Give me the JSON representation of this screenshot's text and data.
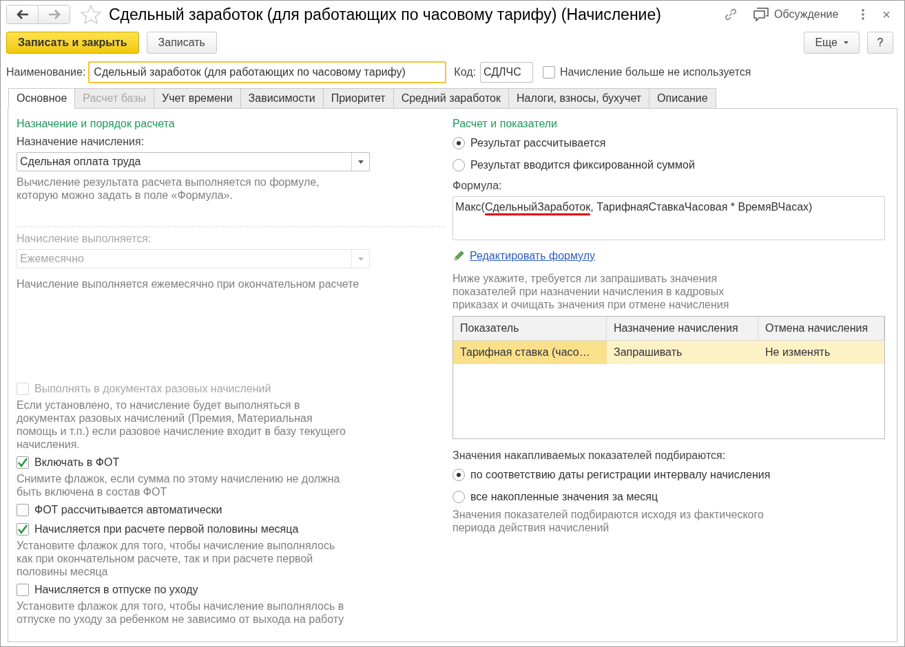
{
  "window": {
    "title": "Сдельный заработок (для работающих по часовому тарифу) (Начисление)",
    "favorite": false,
    "discussion": "Обсуждение",
    "close": "×"
  },
  "toolbar": {
    "primary": "Записать и закрыть",
    "secondary": "Записать",
    "more": "Еще",
    "help": "?"
  },
  "name_field": {
    "label": "Наименование:",
    "value": "Сдельный заработок (для работающих по часовому тарифу)"
  },
  "code_field": {
    "label": "Код:",
    "value": "СДЛЧС"
  },
  "not_used": {
    "label": "Начисление больше не используется",
    "checked": false
  },
  "tabs": [
    {
      "label": "Основное",
      "selected": true,
      "disabled": false
    },
    {
      "label": "Расчет базы",
      "selected": false,
      "disabled": true
    },
    {
      "label": "Учет времени",
      "selected": false,
      "disabled": false
    },
    {
      "label": "Зависимости",
      "selected": false,
      "disabled": false
    },
    {
      "label": "Приоритет",
      "selected": false,
      "disabled": false
    },
    {
      "label": "Средний заработок",
      "selected": false,
      "disabled": false
    },
    {
      "label": "Налоги, взносы, бухучет",
      "selected": false,
      "disabled": false
    },
    {
      "label": "Описание",
      "selected": false,
      "disabled": false
    }
  ],
  "left": {
    "section_title": "Назначение и порядок расчета",
    "purpose": {
      "label": "Назначение начисления:",
      "value": "Сдельная оплата труда",
      "disabled": false
    },
    "purpose_hint": "Вычисление результата расчета выполняется по формуле, которую можно задать в поле «Формула».",
    "frequency": {
      "label": "Начисление выполняется:",
      "value": "Ежемесячно",
      "disabled": true
    },
    "frequency_hint": "Начисление выполняется ежемесячно при окончательном расчете",
    "options": [
      {
        "label": "Выполнять в документах разовых начислений",
        "checked": false,
        "disabled": true,
        "hint": "Если установлено, то начисление будет выполняться в документах разовых начислений (Премия, Материальная помощь и т.п.) если разовое начисление входит в базу текущего начисления."
      },
      {
        "label": "Включать в ФОТ",
        "checked": true,
        "disabled": false,
        "hint": "Снимите флажок, если сумма по этому начислению не должна быть включена в состав ФОТ"
      },
      {
        "label": "ФОТ рассчитывается автоматически",
        "checked": false,
        "disabled": false
      },
      {
        "label": "Начисляется при расчете первой половины месяца",
        "checked": true,
        "disabled": false,
        "hint": "Установите флажок для того, чтобы начисление выполнялось как при окончательном расчете, так и при расчете первой половины месяца"
      },
      {
        "label": "Начисляется в отпуске по уходу",
        "checked": false,
        "disabled": false,
        "hint": "Установите флажок для того, чтобы начисление выполнялось в отпуске по уходу за ребенком не зависимо от выхода на работу"
      }
    ]
  },
  "right": {
    "section_title": "Расчет и показатели",
    "result_modes": [
      {
        "label": "Результат рассчитывается",
        "selected": true
      },
      {
        "label": "Результат вводится фиксированной суммой",
        "selected": false
      }
    ],
    "formula_label": "Формула:",
    "formula": [
      {
        "text": "Макс(",
        "marked": false
      },
      {
        "text": "СдельныйЗаработок",
        "marked": true
      },
      {
        "text": ", ТарифнаяСтавкаЧасовая * ВремяВЧасах)",
        "marked": false
      }
    ],
    "edit_link": "Редактировать формулу",
    "indicators_hint": "Ниже укажите, требуется ли запрашивать значения показателей при назначении начисления в кадровых приказах и очищать значения при отмене начисления",
    "table": {
      "columns": [
        "Показатель",
        "Назначение начисления",
        "Отмена начисления"
      ],
      "rows": [
        {
          "cells": [
            "Тарифная ставка (часо…",
            "Запрашивать",
            "Не изменять"
          ],
          "selected": true
        }
      ]
    },
    "accum_label": "Значения накапливаемых показателей подбираются:",
    "accum_modes": [
      {
        "label": "по соответствию даты регистрации интервалу начисления",
        "selected": true
      },
      {
        "label": "все накопленные значения за месяц",
        "selected": false
      }
    ],
    "accum_hint": "Значения показателей подбираются исходя из фактического периода действия начислений"
  }
}
